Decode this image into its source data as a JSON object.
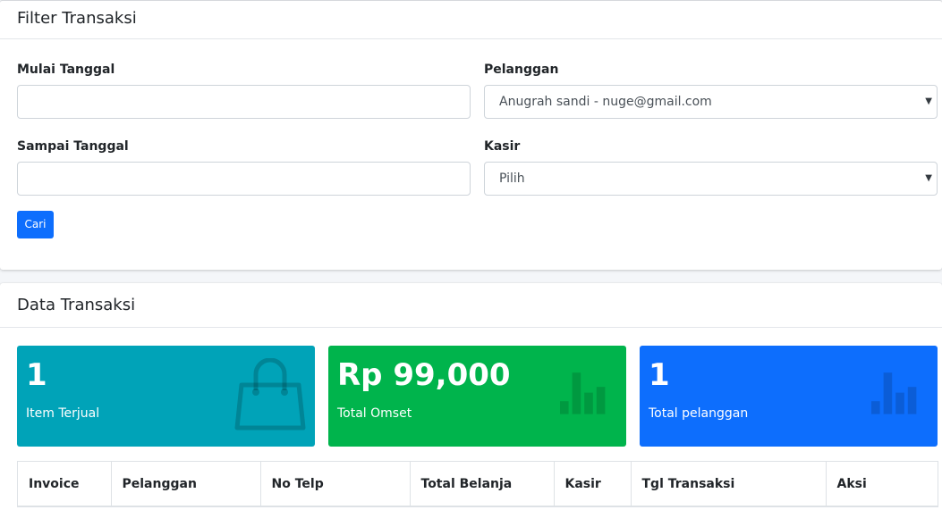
{
  "filter": {
    "title": "Filter Transaksi",
    "start_date": {
      "label": "Mulai Tanggal",
      "value": ""
    },
    "end_date": {
      "label": "Sampai Tanggal",
      "value": ""
    },
    "customer": {
      "label": "Pelanggan",
      "selected": "Anugrah sandi - nuge@gmail.com"
    },
    "cashier": {
      "label": "Kasir",
      "selected": "Pilih"
    },
    "search_button": "Cari"
  },
  "data": {
    "title": "Data Transaksi",
    "stats": [
      {
        "value": "1",
        "label": "Item Terjual",
        "color": "#00a3b8",
        "icon": "shopping-bag-icon"
      },
      {
        "value": "Rp 99,000",
        "label": "Total Omset",
        "color": "#00b44c",
        "icon": "bar-chart-icon"
      },
      {
        "value": "1",
        "label": "Total pelanggan",
        "color": "#0d6efd",
        "icon": "bar-chart-icon"
      }
    ],
    "table": {
      "columns": [
        "Invoice",
        "Pelanggan",
        "No Telp",
        "Total Belanja",
        "Kasir",
        "Tgl Transaksi",
        "Aksi"
      ]
    }
  }
}
